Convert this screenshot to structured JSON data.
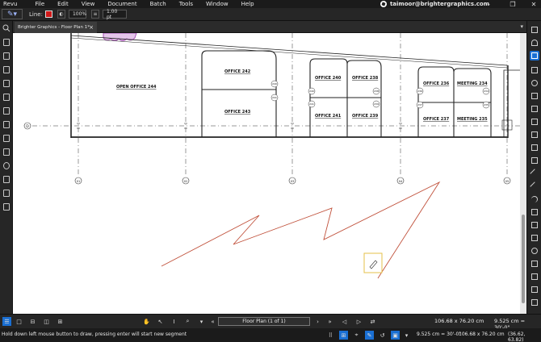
{
  "menu": {
    "items": [
      "Revu",
      "File",
      "Edit",
      "View",
      "Document",
      "Batch",
      "Tools",
      "Window",
      "Help"
    ],
    "user_email": "taimoor@brightergraphics.com"
  },
  "properties": {
    "line_label": "Line:",
    "line_color": "#d01818",
    "opacity": "100%",
    "thickness": "1.00 pt"
  },
  "tab": {
    "title": "Brighter Graphics - Floor Plan 1*",
    "close": "×"
  },
  "drawing": {
    "rooms": [
      {
        "label": "OPEN OFFICE  244"
      },
      {
        "label": "OFFICE  242"
      },
      {
        "label": "OFFICE  243"
      },
      {
        "label": "OFFICE  240"
      },
      {
        "label": "OFFICE  238"
      },
      {
        "label": "OFFICE  241"
      },
      {
        "label": "OFFICE  239"
      },
      {
        "label": "OFFICE  236"
      },
      {
        "label": "MEETING  234"
      },
      {
        "label": "OFFICE  237"
      },
      {
        "label": "MEETING  235"
      }
    ],
    "door_tags": [
      "240",
      "241",
      "240",
      "238",
      "241",
      "239",
      "236",
      "234",
      "237",
      "235"
    ],
    "grid_row": "D",
    "grid_cols": [
      "01",
      "02",
      "03",
      "04",
      "05"
    ],
    "sketch_color": "#c0503a",
    "cursor_box_color": "#e5c04a"
  },
  "navigation": {
    "page_label": "Floor Plan (1 of 1)",
    "page_size": "106.68 x 76.20 cm",
    "scale": "9.525 cm = 30'-0\""
  },
  "status": {
    "message": "Hold down left mouse button to draw, pressing enter will start new segment",
    "scale": "9.525 cm = 30'-0\"",
    "page_size": "106.68 x 76.20 cm",
    "coords": "(36.62, 63.82)"
  }
}
